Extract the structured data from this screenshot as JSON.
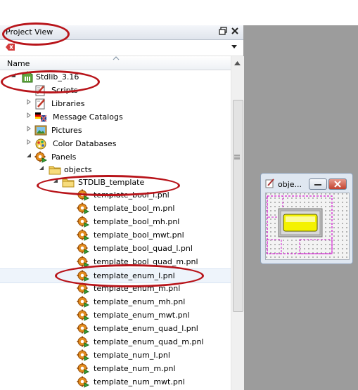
{
  "panel": {
    "title": "Project View",
    "column_header": "Name"
  },
  "tree": [
    {
      "label": "Stdlib_3.16",
      "icon": "project-icon",
      "expander": "open"
    },
    {
      "label": "Scripts",
      "icon": "script-icon",
      "expander": ""
    },
    {
      "label": "Libraries",
      "icon": "library-icon",
      "expander": "closed"
    },
    {
      "label": "Message Catalogs",
      "icon": "message-catalog-icon",
      "expander": "closed"
    },
    {
      "label": "Pictures",
      "icon": "picture-icon",
      "expander": "closed"
    },
    {
      "label": "Color Databases",
      "icon": "color-database-icon",
      "expander": "closed"
    },
    {
      "label": "Panels",
      "icon": "panel-gear-icon",
      "expander": "open"
    },
    {
      "label": "objects",
      "icon": "folder-icon",
      "expander": "open"
    },
    {
      "label": "STDLIB_template",
      "icon": "folder-icon",
      "expander": "open"
    },
    {
      "label": "template_bool_l.pnl",
      "icon": "panel-file-icon",
      "expander": ""
    },
    {
      "label": "template_bool_m.pnl",
      "icon": "panel-file-icon",
      "expander": ""
    },
    {
      "label": "template_bool_mh.pnl",
      "icon": "panel-file-icon",
      "expander": ""
    },
    {
      "label": "template_bool_mwt.pnl",
      "icon": "panel-file-icon",
      "expander": ""
    },
    {
      "label": "template_bool_quad_l.pnl",
      "icon": "panel-file-icon",
      "expander": ""
    },
    {
      "label": "template_bool_quad_m.pnl",
      "icon": "panel-file-icon",
      "expander": ""
    },
    {
      "label": "template_enum_l.pnl",
      "icon": "panel-file-icon",
      "expander": "",
      "selected": true
    },
    {
      "label": "template_enum_m.pnl",
      "icon": "panel-file-icon",
      "expander": ""
    },
    {
      "label": "template_enum_mh.pnl",
      "icon": "panel-file-icon",
      "expander": ""
    },
    {
      "label": "template_enum_mwt.pnl",
      "icon": "panel-file-icon",
      "expander": ""
    },
    {
      "label": "template_enum_quad_l.pnl",
      "icon": "panel-file-icon",
      "expander": ""
    },
    {
      "label": "template_enum_quad_m.pnl",
      "icon": "panel-file-icon",
      "expander": ""
    },
    {
      "label": "template_num_l.pnl",
      "icon": "panel-file-icon",
      "expander": ""
    },
    {
      "label": "template_num_m.pnl",
      "icon": "panel-file-icon",
      "expander": ""
    },
    {
      "label": "template_num_mwt.pnl",
      "icon": "panel-file-icon",
      "expander": ""
    }
  ],
  "mini_window": {
    "title": "obje..."
  },
  "colors": {
    "highlight_marker": "#b8141a",
    "gray_background": "#9c9c9c",
    "preview_yellow": "#f4f200",
    "preview_magenta": "#d020d0"
  }
}
